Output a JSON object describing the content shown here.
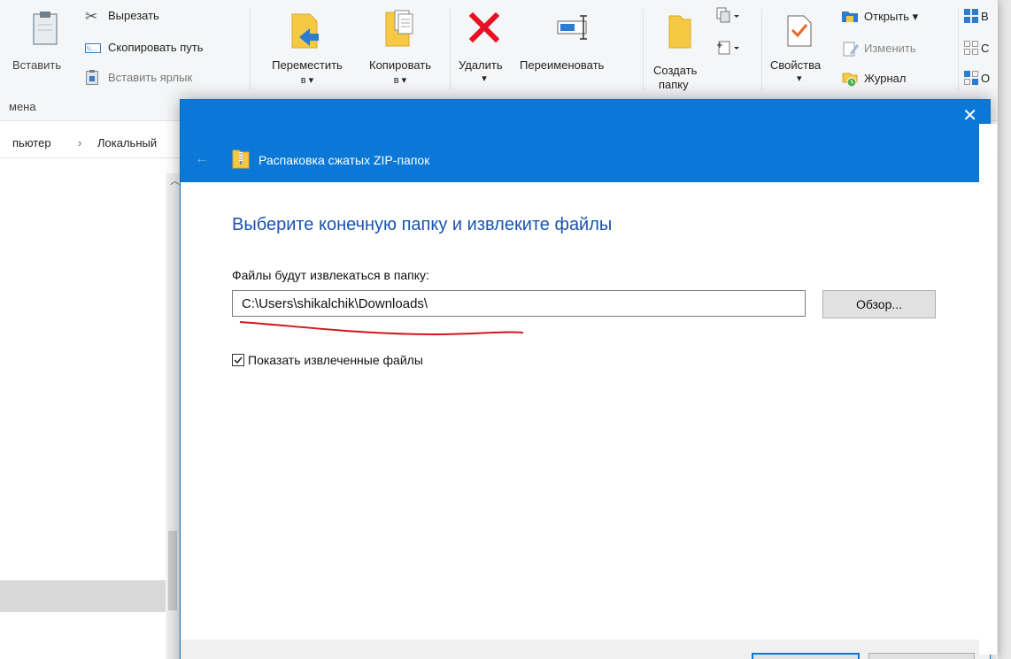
{
  "ribbon": {
    "paste_label": "Вставить",
    "cut_label": "Вырезать",
    "copy_path_label": "Скопировать путь",
    "paste_shortcut_label": "Вставить ярлык",
    "move_to_line1": "Переместить",
    "move_to_line2": "в ▾",
    "copy_to_line1": "Копировать",
    "copy_to_line2": "в ▾",
    "delete_label": "Удалить",
    "delete_arrow": "▾",
    "rename_label": "Переименовать",
    "new_folder_line1": "Создать",
    "new_folder_line2": "папку",
    "properties_label": "Свойства",
    "properties_arrow": "▾",
    "open_label": "Открыть ▾",
    "edit_label": "Изменить",
    "history_label": "Журнал",
    "select_partial_1": "В",
    "select_partial_2": "С",
    "select_partial_3": "О",
    "group_label": "мена"
  },
  "address": {
    "computer": "пьютер",
    "separator": "›",
    "local": "Локальный"
  },
  "dialog": {
    "title": "Распаковка сжатых ZIP-папок",
    "heading": "Выберите конечную папку и извлеките файлы",
    "path_label": "Файлы будут извлекаться в папку:",
    "path_value": "C:\\Users\\shikalchik\\Downloads\\",
    "browse_label": "Обзор...",
    "show_files_label": "Показать извлеченные файлы",
    "show_files_checked": true
  },
  "colors": {
    "accent": "#0b78d7",
    "heading": "#1a53b0",
    "annotation": "#d4141a",
    "delete_red": "#e81123",
    "folder_yellow": "#f6c945"
  }
}
